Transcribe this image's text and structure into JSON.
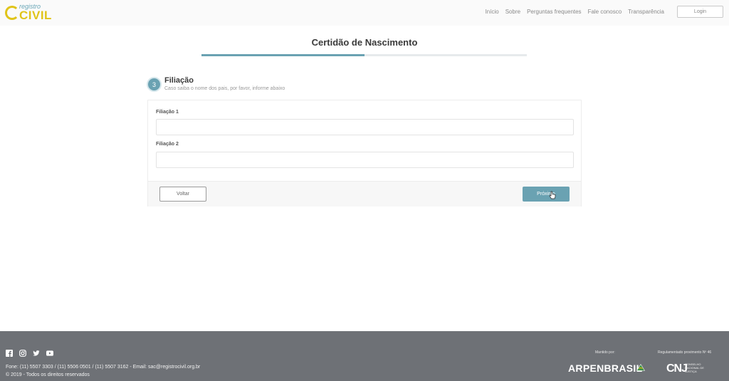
{
  "header": {
    "logo_small": "registro",
    "logo_main": "CIVIL",
    "nav": [
      "Início",
      "Sobre",
      "Perguntas frequentes",
      "Fale conosco",
      "Transparência"
    ],
    "login_label": "Login"
  },
  "page": {
    "title": "Certidão de Nascimento",
    "progress": 0.5
  },
  "step": {
    "number": "3",
    "title": "Filiação",
    "subtitle": "Caso saiba o nome dos pais, por favor, informe abaixo"
  },
  "form": {
    "field1_label": "Filiação 1",
    "field1_value": "",
    "field2_label": "Filiação 2",
    "field2_value": "",
    "back_label": "Voltar",
    "next_label": "Próximo"
  },
  "footer": {
    "social_icons": [
      "facebook-icon",
      "instagram-icon",
      "twitter-icon",
      "youtube-icon"
    ],
    "contact": "Fone: (11) 5507 3303 / (11) 5506 0501 / (11) 5507 3162 - Email: sac@registrocivil.org.br",
    "copyright": "© 2019 - Todos os direitos reservados",
    "mantido_label": "Mantido por:",
    "regulamentado_label": "Regulamentado provimento Nº 46",
    "arpen_logo": "ARPENBRASIL",
    "cnj_logo": "CNJ",
    "cnj_sub": "CONSELHO NACIONAL DE JUSTIÇA"
  },
  "colors": {
    "accent": "#6aa2b2",
    "footer_bg": "#6e7176",
    "logo_yellow": "#e0c419"
  }
}
